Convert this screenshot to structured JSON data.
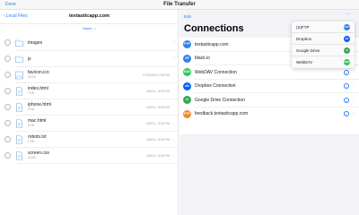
{
  "app": {
    "title": "File Transfer",
    "done_label": "Done"
  },
  "left": {
    "back_label": "Local Files",
    "host": "textasticapp.com",
    "sort_label": "Name"
  },
  "files": [
    {
      "name": "images",
      "size": "",
      "date": "",
      "type": "folder"
    },
    {
      "name": "js",
      "size": "",
      "date": "",
      "type": "folder"
    },
    {
      "name": "favicon.ico",
      "size": "24 KB",
      "date": "07/02/2020, 2:35 PM",
      "type": "image"
    },
    {
      "name": "index.html",
      "size": "7 KB",
      "date": "4/20/21, 10:03 PM",
      "type": "doc"
    },
    {
      "name": "iphone.html",
      "size": "8 KB",
      "date": "4/20/21, 10:03 PM",
      "type": "doc"
    },
    {
      "name": "mac.html",
      "size": "8 KB",
      "date": "4/20/21, 10:03 PM",
      "type": "doc"
    },
    {
      "name": "robots.txt",
      "size": "1 KB",
      "date": "4/20/21, 10:03 PM",
      "type": "doc"
    },
    {
      "name": "screen.css",
      "size": "14 KB",
      "date": "4/20/21, 10:03 PM",
      "type": "doc"
    }
  ],
  "right": {
    "edit_label": "Edit",
    "more_label": "···",
    "title": "Connections"
  },
  "connections": [
    {
      "label": "textasticapp.com",
      "icon": "FTP",
      "color": "#2f80ed"
    },
    {
      "label": "black.io",
      "icon": "SF",
      "color": "#2f80ed"
    },
    {
      "label": "WebDAV Connection",
      "icon": "DAV",
      "color": "#34c759"
    },
    {
      "label": "Dropbox Connection",
      "icon": "db",
      "color": "#0061fe"
    },
    {
      "label": "Google Drive Connection",
      "icon": "G",
      "color": "#34a853"
    },
    {
      "label": "feedback.textasticapp.com",
      "icon": "FTP",
      "color": "#f08c24"
    }
  ],
  "popup": [
    {
      "label": "(S)FTP",
      "icon": "FTP",
      "color": "#2f80ed"
    },
    {
      "label": "Dropbox",
      "icon": "db",
      "color": "#0061fe"
    },
    {
      "label": "Google Drive",
      "icon": "G",
      "color": "#34a853"
    },
    {
      "label": "WebDAV",
      "icon": "DAV",
      "color": "#34c759"
    }
  ],
  "info_glyph": "i",
  "chevron_glyph": "›"
}
